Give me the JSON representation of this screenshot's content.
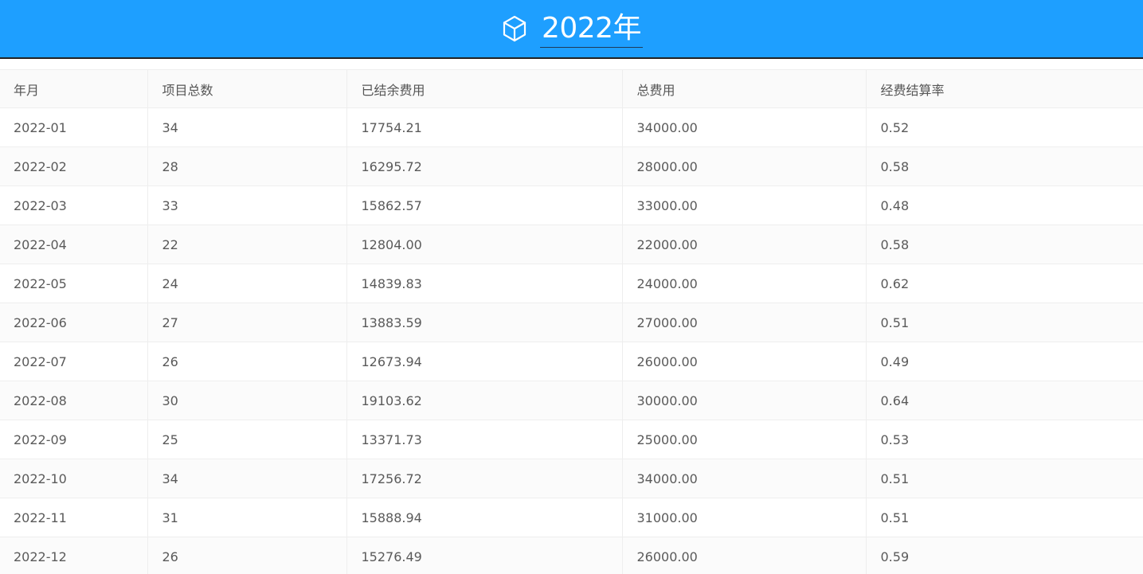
{
  "header": {
    "title": "2022年",
    "icon": "cube-icon",
    "background": "#1e9fff"
  },
  "table": {
    "columns": [
      "年月",
      "项目总数",
      "已结余费用",
      "总费用",
      "经费结算率"
    ],
    "rows": [
      [
        "2022-01",
        "34",
        "17754.21",
        "34000.00",
        "0.52"
      ],
      [
        "2022-02",
        "28",
        "16295.72",
        "28000.00",
        "0.58"
      ],
      [
        "2022-03",
        "33",
        "15862.57",
        "33000.00",
        "0.48"
      ],
      [
        "2022-04",
        "22",
        "12804.00",
        "22000.00",
        "0.58"
      ],
      [
        "2022-05",
        "24",
        "14839.83",
        "24000.00",
        "0.62"
      ],
      [
        "2022-06",
        "27",
        "13883.59",
        "27000.00",
        "0.51"
      ],
      [
        "2022-07",
        "26",
        "12673.94",
        "26000.00",
        "0.49"
      ],
      [
        "2022-08",
        "30",
        "19103.62",
        "30000.00",
        "0.64"
      ],
      [
        "2022-09",
        "25",
        "13371.73",
        "25000.00",
        "0.53"
      ],
      [
        "2022-10",
        "34",
        "17256.72",
        "34000.00",
        "0.51"
      ],
      [
        "2022-11",
        "31",
        "15888.94",
        "31000.00",
        "0.51"
      ],
      [
        "2022-12",
        "26",
        "15276.49",
        "26000.00",
        "0.59"
      ]
    ]
  }
}
